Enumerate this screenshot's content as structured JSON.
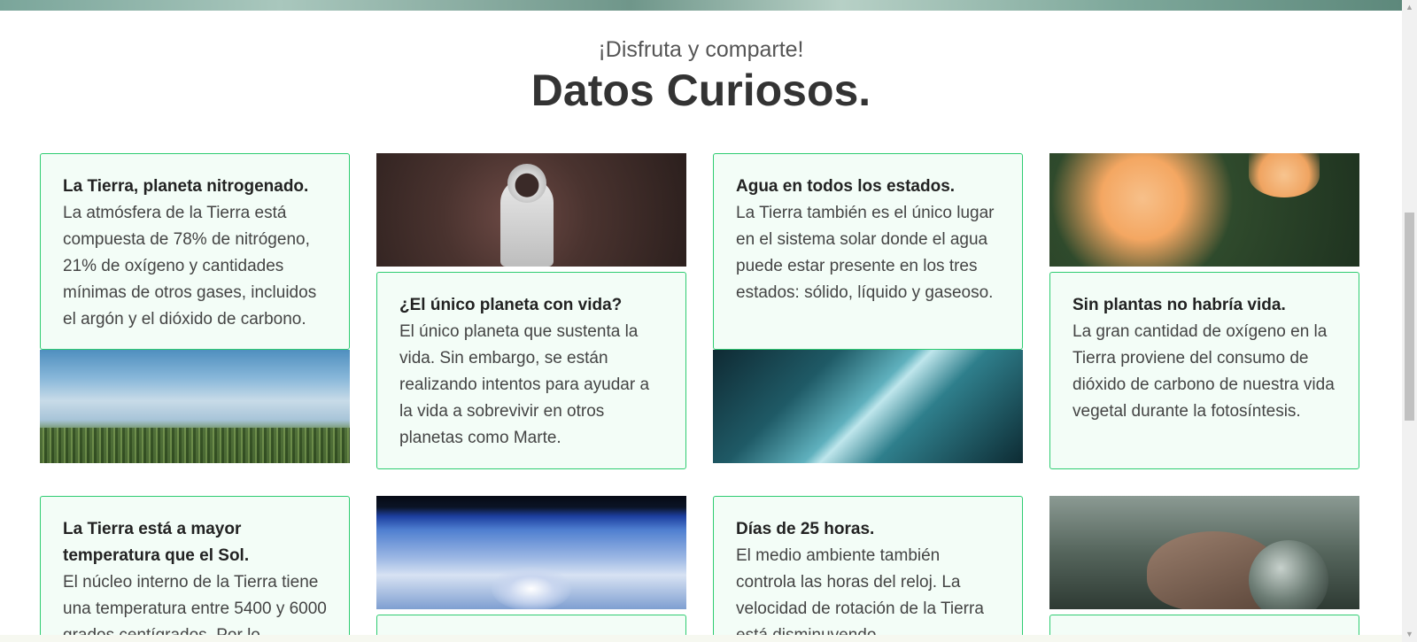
{
  "section": {
    "subtitle": "¡Disfruta y comparte!",
    "title": "Datos Curiosos."
  },
  "cards": [
    {
      "title": "La Tierra, planeta nitrogenado.",
      "text": "La atmósfera de la Tierra está compuesta de 78% de nitrógeno, 21% de oxígeno y cantidades mínimas de otros gases, incluidos el argón y el dióxido de carbono."
    },
    {
      "title": "¿El único planeta con vida?",
      "text": "El único planeta que sustenta la vida. Sin embargo, se están realizando intentos para ayudar a la vida a sobrevivir en otros planetas como Marte."
    },
    {
      "title": "Agua en todos los estados.",
      "text": "La Tierra también es el único lugar en el sistema solar donde el agua puede estar presente en los tres estados: sólido, líquido y gaseoso."
    },
    {
      "title": "Sin plantas no habría vida.",
      "text": "La gran cantidad de oxígeno en la Tierra proviene del consumo de dióxido de carbono de nuestra vida vegetal durante la fotosíntesis."
    },
    {
      "title": "La Tierra está a mayor temperatura que el Sol.",
      "text": "El núcleo interno de la Tierra tiene una temperatura entre 5400 y 6000 grados centígrados. Por lo"
    },
    {
      "title": "Días de 25 horas.",
      "text": "El medio ambiente también controla las horas del reloj. La velocidad de rotación de la Tierra está disminuyendo"
    }
  ],
  "images": {
    "sky": "sky-grass-image",
    "astronaut": "astronaut-image",
    "ice": "ice-water-image",
    "rose": "rose-image",
    "earth": "earth-storm-image",
    "hand": "hand-globe-image"
  },
  "colors": {
    "card_border": "#2ecc71",
    "card_background": "#f3fdf7"
  }
}
